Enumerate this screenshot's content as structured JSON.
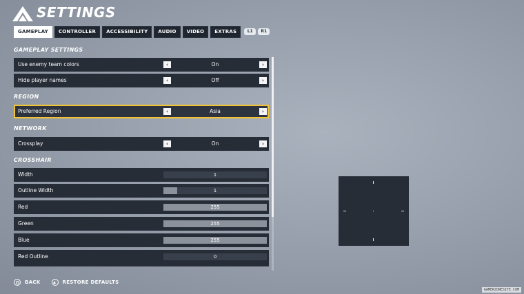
{
  "header": {
    "title": "SETTINGS"
  },
  "tabs": [
    {
      "label": "GAMEPLAY",
      "active": true
    },
    {
      "label": "CONTROLLER"
    },
    {
      "label": "ACCESSIBILITY"
    },
    {
      "label": "AUDIO"
    },
    {
      "label": "VIDEO"
    },
    {
      "label": "EXTRAS"
    }
  ],
  "bumpers": {
    "left": "L1",
    "right": "R1"
  },
  "sections": {
    "gameplay": "GAMEPLAY SETTINGS",
    "region": "REGION",
    "network": "NETWORK",
    "crosshair": "CROSSHAIR"
  },
  "settings": {
    "enemy_colors": {
      "label": "Use enemy team colors",
      "value": "On"
    },
    "player_names": {
      "label": "Hide player names",
      "value": "Off"
    },
    "region": {
      "label": "Preferred Region",
      "value": "Asia"
    },
    "crossplay": {
      "label": "Crossplay",
      "value": "On"
    }
  },
  "crosshair": [
    {
      "label": "Width",
      "value": "1",
      "fill": 0.0
    },
    {
      "label": "Outline Width",
      "value": "1",
      "fill": 0.13
    },
    {
      "label": "Red",
      "value": "255",
      "fill": 1.0
    },
    {
      "label": "Green",
      "value": "255",
      "fill": 1.0
    },
    {
      "label": "Blue",
      "value": "255",
      "fill": 1.0
    },
    {
      "label": "Red Outline",
      "value": "0",
      "fill": 0.0
    }
  ],
  "footer": {
    "back": "BACK",
    "restore": "RESTORE DEFAULTS"
  },
  "colors": {
    "accent": "#f2c335",
    "panel": "#262d37"
  },
  "watermark": "GAMERZONESITE.COM"
}
